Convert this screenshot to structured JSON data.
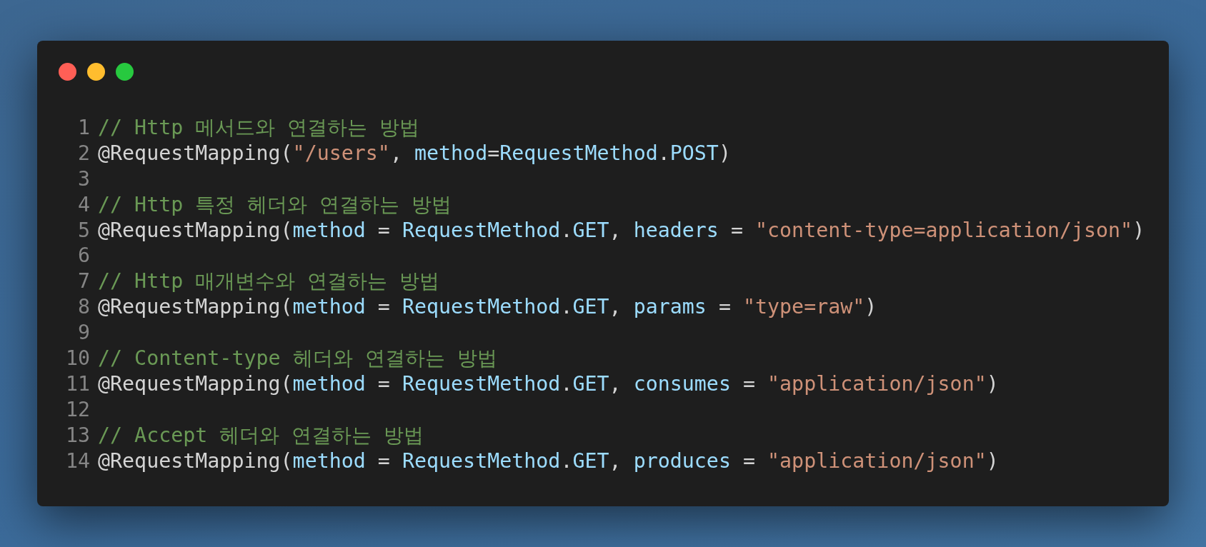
{
  "window": {
    "controls": [
      {
        "color": "#ff5f56"
      },
      {
        "color": "#ffbd2e"
      },
      {
        "color": "#27c93f"
      }
    ]
  },
  "code": {
    "lines": [
      {
        "number": "1",
        "tokens": [
          {
            "kind": "comment",
            "text": "// Http 메서드와 연결하는 방법"
          }
        ]
      },
      {
        "number": "2",
        "tokens": [
          {
            "kind": "plain",
            "text": "@RequestMapping("
          },
          {
            "kind": "string",
            "text": "\"/users\""
          },
          {
            "kind": "plain",
            "text": ", "
          },
          {
            "kind": "variable",
            "text": "method"
          },
          {
            "kind": "plain",
            "text": "="
          },
          {
            "kind": "variable",
            "text": "RequestMethod"
          },
          {
            "kind": "plain",
            "text": "."
          },
          {
            "kind": "variable",
            "text": "POST"
          },
          {
            "kind": "plain",
            "text": ")"
          }
        ]
      },
      {
        "number": "3"
      },
      {
        "number": "4",
        "tokens": [
          {
            "kind": "comment",
            "text": "// Http 특정 헤더와 연결하는 방법"
          }
        ]
      },
      {
        "number": "5",
        "tokens": [
          {
            "kind": "plain",
            "text": "@RequestMapping("
          },
          {
            "kind": "variable",
            "text": "method"
          },
          {
            "kind": "plain",
            "text": " = "
          },
          {
            "kind": "variable",
            "text": "RequestMethod"
          },
          {
            "kind": "plain",
            "text": "."
          },
          {
            "kind": "variable",
            "text": "GET"
          },
          {
            "kind": "plain",
            "text": ", "
          },
          {
            "kind": "variable",
            "text": "headers"
          },
          {
            "kind": "plain",
            "text": " = "
          },
          {
            "kind": "string",
            "text": "\"content-type=application/json\""
          },
          {
            "kind": "plain",
            "text": ")"
          }
        ]
      },
      {
        "number": "6"
      },
      {
        "number": "7",
        "tokens": [
          {
            "kind": "comment",
            "text": "// Http 매개변수와 연결하는 방법"
          }
        ]
      },
      {
        "number": "8",
        "tokens": [
          {
            "kind": "plain",
            "text": "@RequestMapping("
          },
          {
            "kind": "variable",
            "text": "method"
          },
          {
            "kind": "plain",
            "text": " = "
          },
          {
            "kind": "variable",
            "text": "RequestMethod"
          },
          {
            "kind": "plain",
            "text": "."
          },
          {
            "kind": "variable",
            "text": "GET"
          },
          {
            "kind": "plain",
            "text": ", "
          },
          {
            "kind": "variable",
            "text": "params"
          },
          {
            "kind": "plain",
            "text": " = "
          },
          {
            "kind": "string",
            "text": "\"type=raw\""
          },
          {
            "kind": "plain",
            "text": ")"
          }
        ]
      },
      {
        "number": "9"
      },
      {
        "number": "10",
        "tokens": [
          {
            "kind": "comment",
            "text": "// Content-type 헤더와 연결하는 방법"
          }
        ]
      },
      {
        "number": "11",
        "tokens": [
          {
            "kind": "plain",
            "text": "@RequestMapping("
          },
          {
            "kind": "variable",
            "text": "method"
          },
          {
            "kind": "plain",
            "text": " = "
          },
          {
            "kind": "variable",
            "text": "RequestMethod"
          },
          {
            "kind": "plain",
            "text": "."
          },
          {
            "kind": "variable",
            "text": "GET"
          },
          {
            "kind": "plain",
            "text": ", "
          },
          {
            "kind": "variable",
            "text": "consumes"
          },
          {
            "kind": "plain",
            "text": " = "
          },
          {
            "kind": "string",
            "text": "\"application/json\""
          },
          {
            "kind": "plain",
            "text": ")"
          }
        ]
      },
      {
        "number": "12"
      },
      {
        "number": "13",
        "tokens": [
          {
            "kind": "comment",
            "text": "// Accept 헤더와 연결하는 방법"
          }
        ]
      },
      {
        "number": "14",
        "tokens": [
          {
            "kind": "plain",
            "text": "@RequestMapping("
          },
          {
            "kind": "variable",
            "text": "method"
          },
          {
            "kind": "plain",
            "text": " = "
          },
          {
            "kind": "variable",
            "text": "RequestMethod"
          },
          {
            "kind": "plain",
            "text": "."
          },
          {
            "kind": "variable",
            "text": "GET"
          },
          {
            "kind": "plain",
            "text": ", "
          },
          {
            "kind": "variable",
            "text": "produces"
          },
          {
            "kind": "plain",
            "text": " = "
          },
          {
            "kind": "string",
            "text": "\"application/json\""
          },
          {
            "kind": "plain",
            "text": ")"
          }
        ]
      }
    ]
  }
}
